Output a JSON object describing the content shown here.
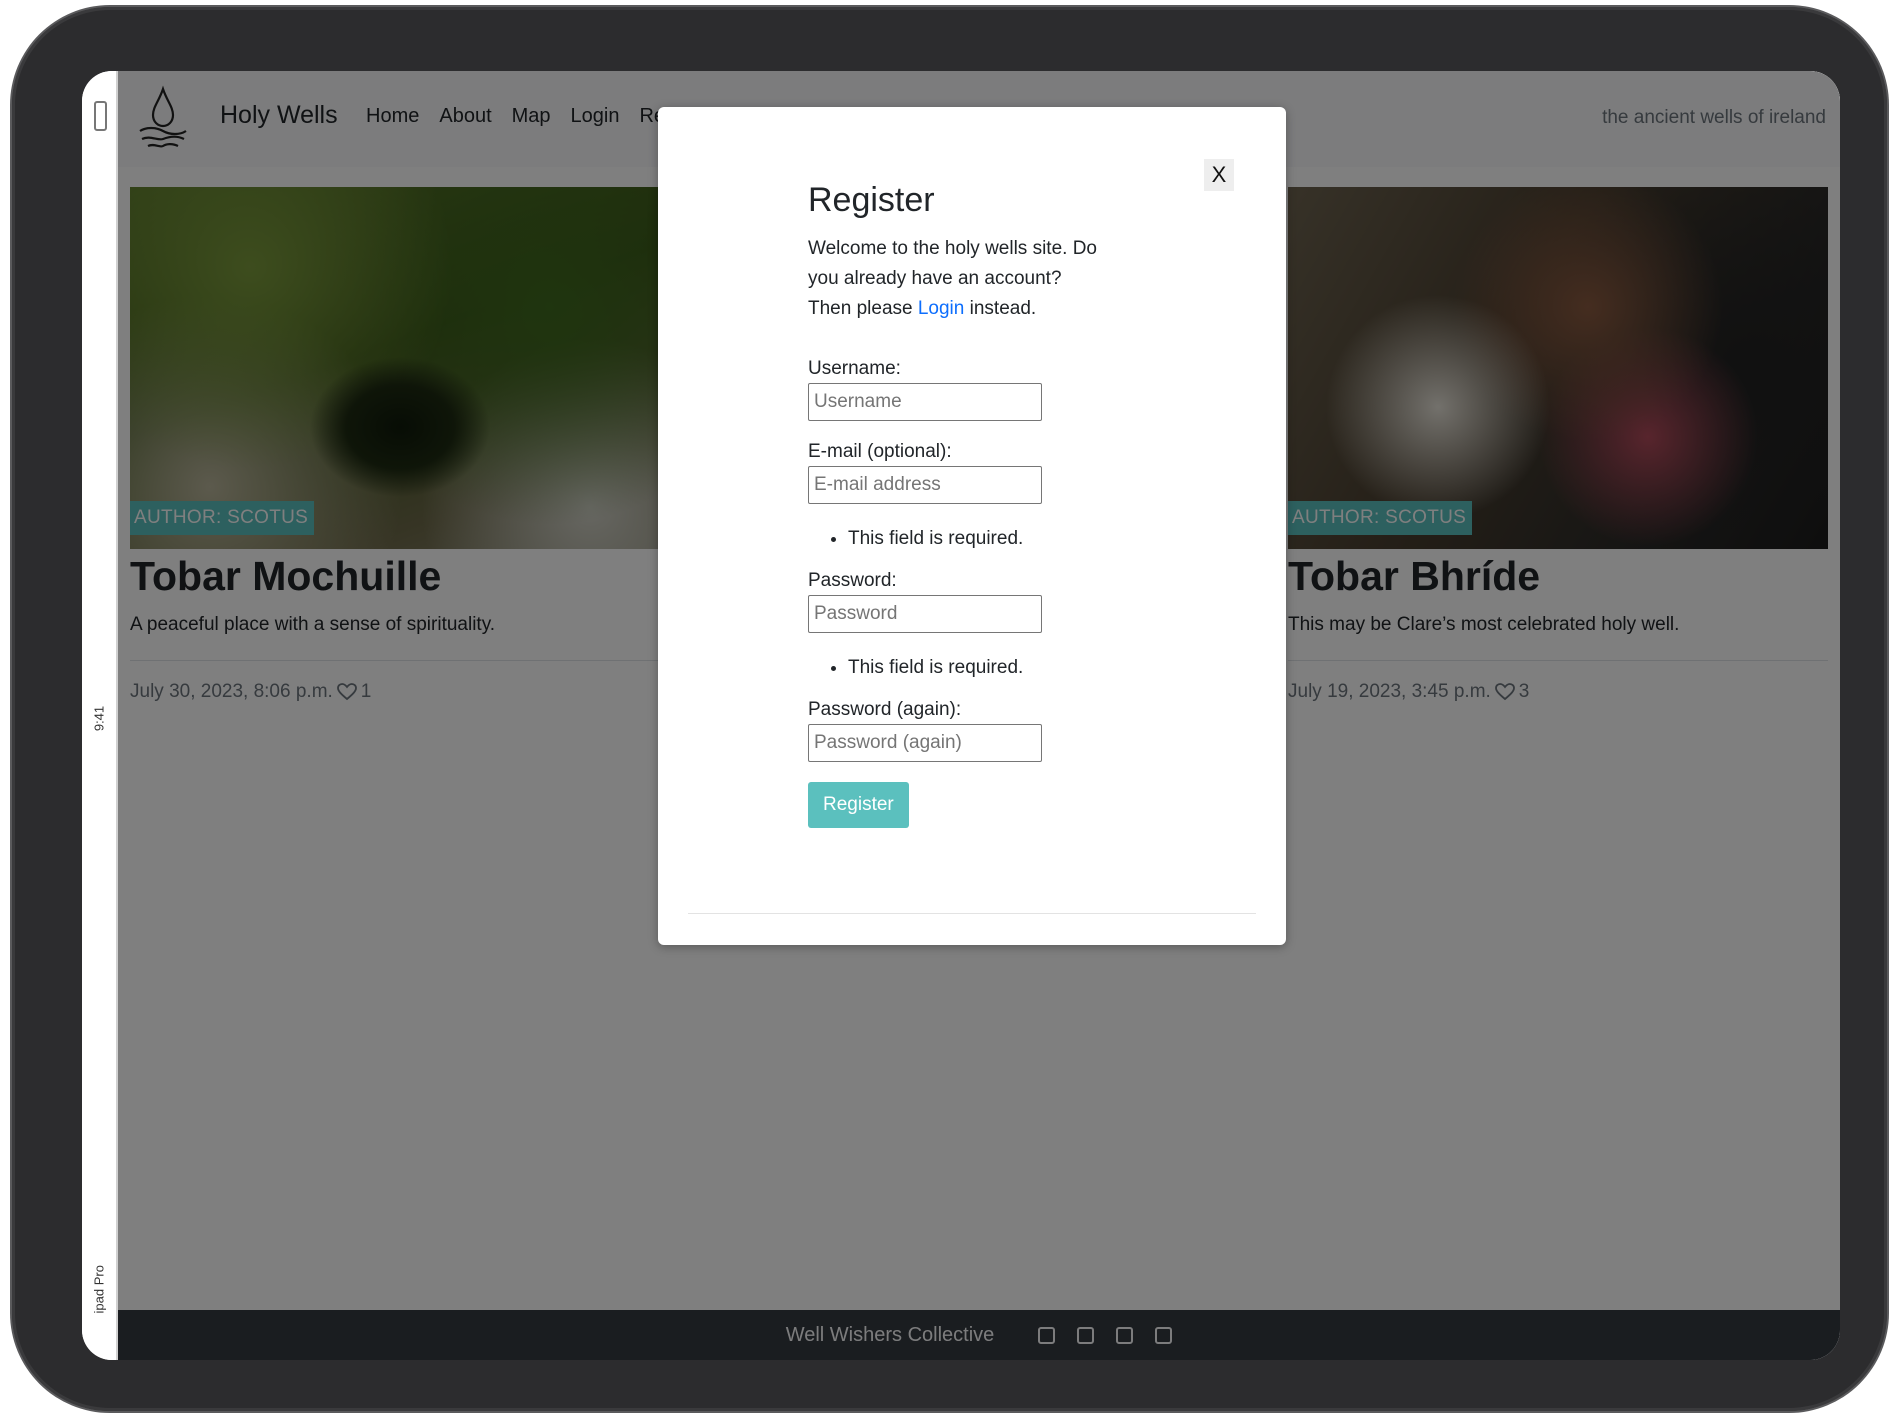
{
  "status_bar": {
    "time": "9:41",
    "device": "ipad Pro"
  },
  "navbar": {
    "brand": "Holy Wells",
    "links": [
      "Home",
      "About",
      "Map",
      "Login",
      "Register"
    ],
    "tagline": "the ancient wells of ireland"
  },
  "cards": [
    {
      "author": "AUTHOR: SCOTUS",
      "title": "Tobar Mochuille",
      "excerpt": "A peaceful place with a sense of spirituality.",
      "date": "July 30, 2023, 8:06 p.m.",
      "likes": "1"
    },
    {
      "author": "AUTHOR: SCOTUS",
      "title": "Tobar Bhríde",
      "excerpt": "This may be Clare’s most celebrated holy well.",
      "date": "July 19, 2023, 3:45 p.m.",
      "likes": "3"
    }
  ],
  "modal": {
    "close_label": "X",
    "title": "Register",
    "intro_before": "Welcome to the holy wells site. Do you already have an account? Then please ",
    "intro_link": "Login",
    "intro_after": " instead.",
    "fields": {
      "username": {
        "label": "Username:",
        "placeholder": "Username"
      },
      "email": {
        "label": "E-mail (optional):",
        "placeholder": "E-mail address",
        "error": "This field is required."
      },
      "password": {
        "label": "Password:",
        "placeholder": "Password",
        "error": "This field is required."
      },
      "password2": {
        "label": "Password (again):",
        "placeholder": "Password (again)"
      }
    },
    "submit_label": "Register"
  },
  "footer": {
    "text": "Well Wishers Collective",
    "social_icons": [
      "facebook-icon",
      "twitter-icon",
      "instagram-icon",
      "youtube-icon"
    ]
  },
  "colors": {
    "accent": "#5bc0be",
    "footer_bg": "#343a40",
    "link": "#0d6efd"
  }
}
